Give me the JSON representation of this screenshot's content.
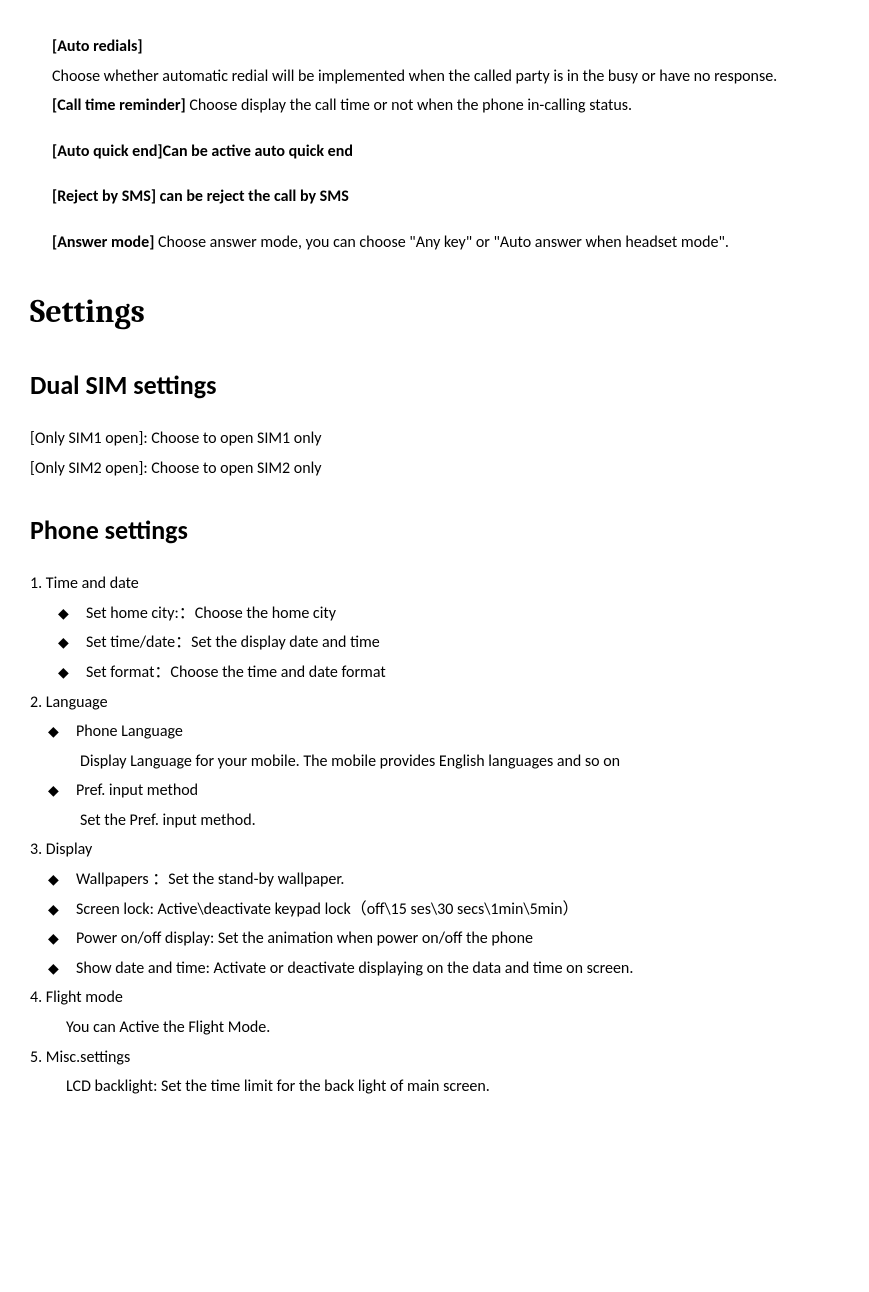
{
  "autoRedials": {
    "title": "[Auto redials]",
    "text": "Choose whether automatic redial will be implemented when the called party is in the busy or have no response."
  },
  "callTimeReminder": {
    "bold": "[Call time reminder] ",
    "text": "Choose display the call time or not when the phone in-calling status."
  },
  "autoQuickEnd": "[Auto quick end]Can be active auto quick end",
  "rejectBySms": "[Reject by SMS] can be reject the call by SMS",
  "answerMode": {
    "bold": "[Answer mode] ",
    "text": "Choose answer mode, you can choose \"Any key\" or \"Auto answer when headset mode\"."
  },
  "h1Settings": "Settings",
  "h2DualSim": "Dual SIM settings",
  "dualSim1": "[Only SIM1 open]: Choose to open SIM1 only",
  "dualSim2": "[Only SIM2 open]: Choose to open SIM2 only",
  "h2Phone": "Phone settings",
  "phone1": "1. Time and date",
  "phone1b1": "Set   home   city:：Choose the home city",
  "phone1b2": "Set   time/date：Set the display date and time",
  "phone1b3": "Set   format：Choose the time and date format",
  "phone2": "2. Language",
  "phone2b1": "Phone Language",
  "phone2b1desc": "Display Language for your mobile. The mobile provides English languages and so on",
  "phone2b2": "Pref. input   method",
  "phone2b2desc": "Set the Pref. input method.",
  "phone3": "3. Display",
  "phone3b1": "Wallpapers ：Set the stand-by wallpaper.",
  "phone3b2": "Screen lock:  Active\\deactivate keypad lock（off\\15 ses\\30 secs\\1min\\5min）",
  "phone3b3": "Power on/off display: Set the animation when power on/off the phone",
  "phone3b4": "Show date and time: Activate or deactivate displaying on the data and time on screen.",
  "phone4": "4. Flight mode",
  "phone4desc": "You can Active the Flight Mode.",
  "phone5": "5. Misc.settings",
  "phone5desc": "LCD backlight: Set the time limit for the back light of main screen."
}
